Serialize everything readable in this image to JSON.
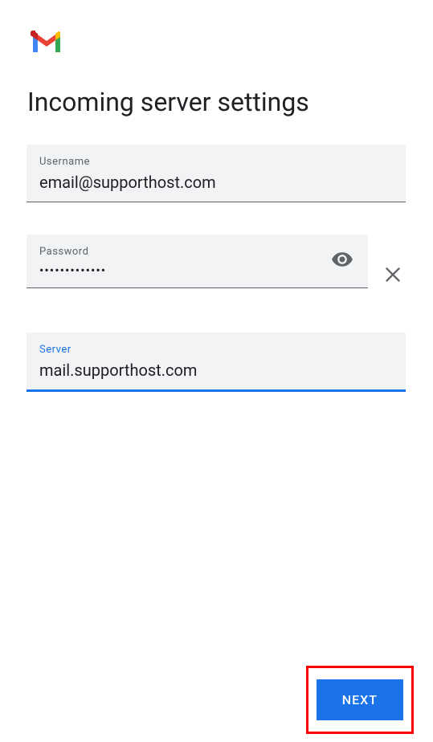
{
  "title": "Incoming server settings",
  "fields": {
    "username": {
      "label": "Username",
      "value": "email@supporthost.com"
    },
    "password": {
      "label": "Password",
      "value": "•••••••••••••"
    },
    "server": {
      "label": "Server",
      "value": "mail.supporthost.com"
    }
  },
  "buttons": {
    "next": "NEXT"
  }
}
